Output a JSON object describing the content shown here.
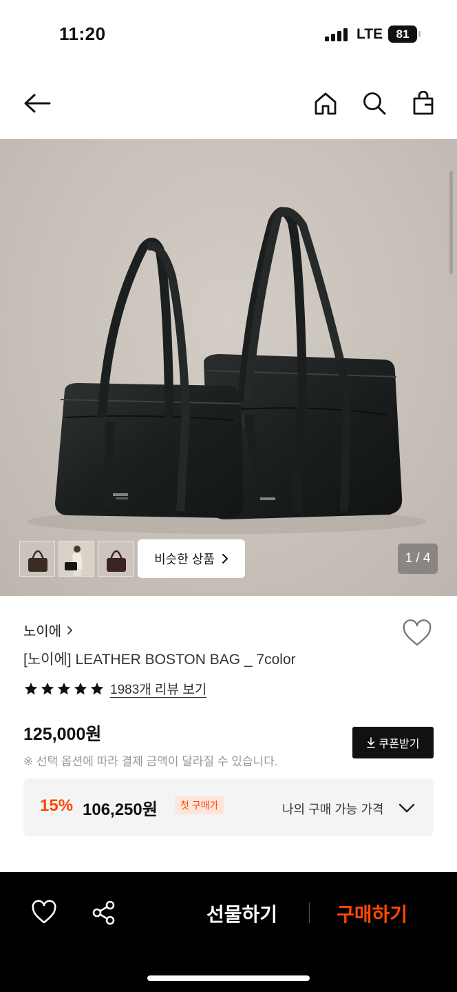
{
  "status_bar": {
    "time": "11:20",
    "network": "LTE",
    "battery": "81"
  },
  "header": {
    "icons": [
      "back-arrow-icon",
      "home-icon",
      "search-icon",
      "shopping-bag-icon"
    ]
  },
  "gallery": {
    "thumbnails": [
      "bag-thumbnail-1",
      "model-thumbnail",
      "bag-thumbnail-2"
    ],
    "similar_label": "비슷한 상품",
    "page_indicator": "1 / 4"
  },
  "product": {
    "brand": "노이에",
    "title": "[노이에] LEATHER BOSTON BAG _ 7color",
    "rating_stars": 5,
    "review_link": "1983개 리뷰 보기",
    "price": "125,000원",
    "price_note": "※ 선택 옵션에 따라 결제 금액이 달라질 수 있습니다.",
    "coupon_label": "쿠폰받기"
  },
  "discount": {
    "rate": "15%",
    "price": "106,250원",
    "badge": "첫 구매가",
    "available_label": "나의 구매 가능 가격"
  },
  "bottom_bar": {
    "gift_label": "선물하기",
    "buy_label": "구매하기"
  },
  "colors": {
    "accent": "#ff4800",
    "dark": "#000000",
    "badge_bg": "#fde5dd"
  }
}
